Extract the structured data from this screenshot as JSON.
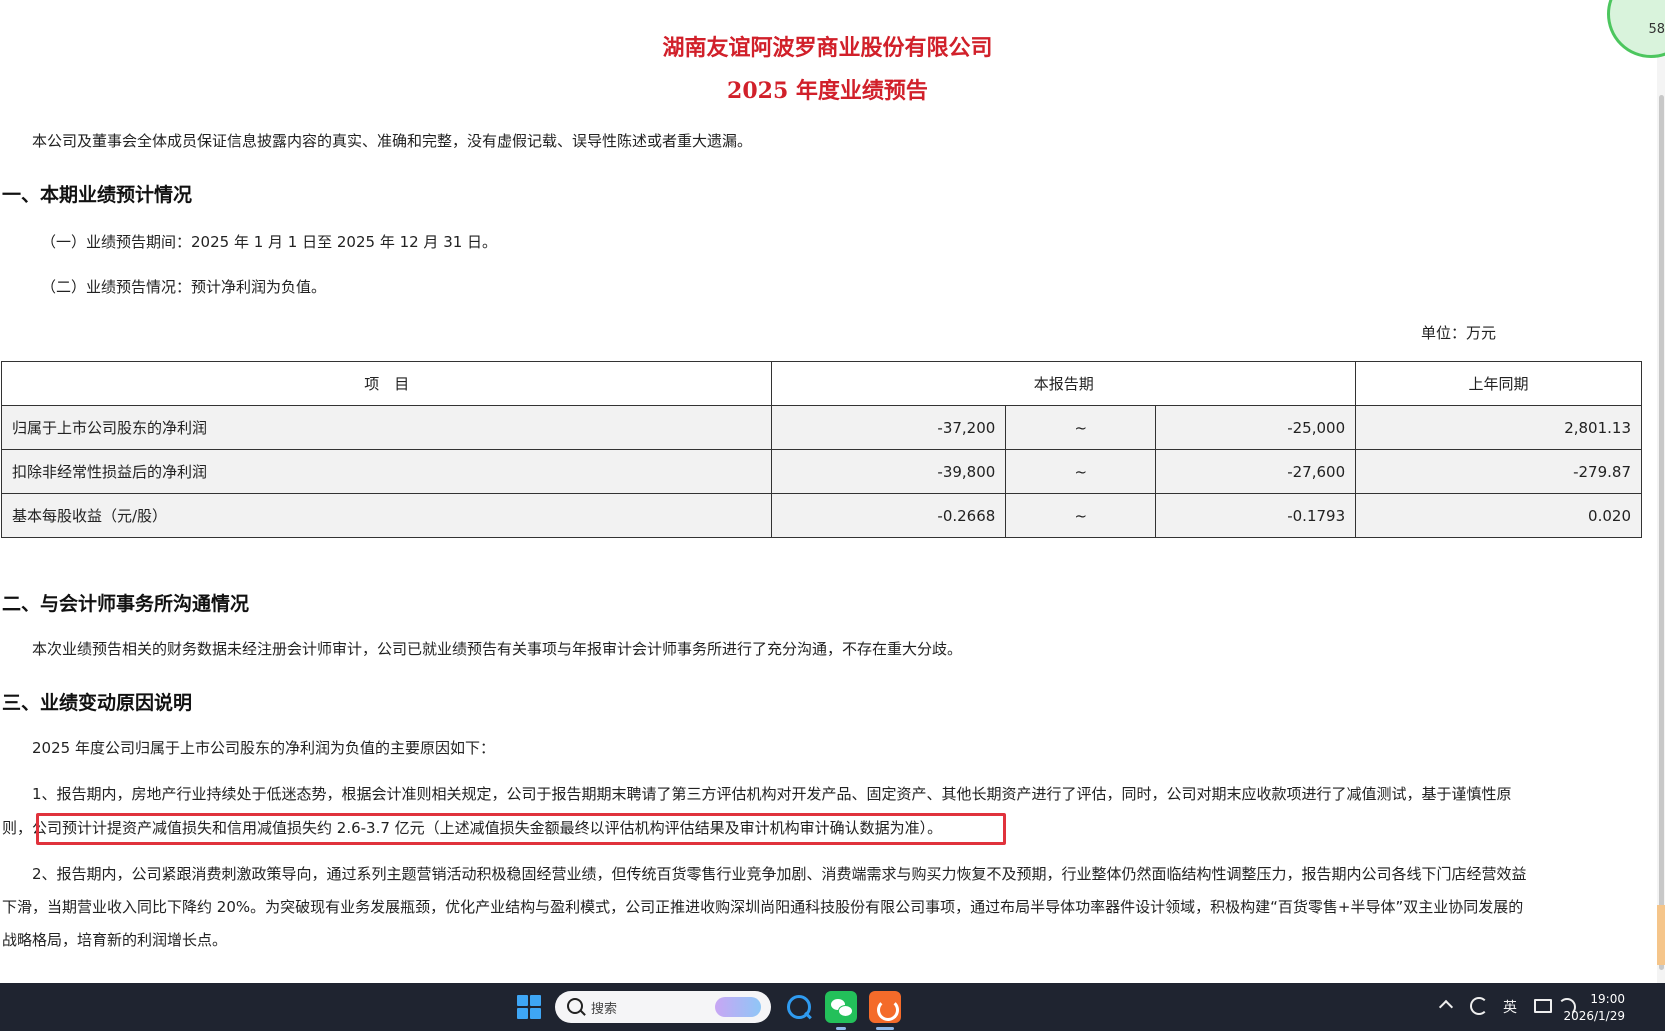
{
  "document": {
    "company": "湖南友谊阿波罗商业股份有限公司",
    "title": "2025 年度业绩预告",
    "disclaimer": "本公司及董事会全体成员保证信息披露内容的真实、准确和完整，没有虚假记载、误导性陈述或者重大遗漏。",
    "section1": {
      "heading": "一、本期业绩预计情况",
      "period": "（一）业绩预告期间：2025 年 1 月 1 日至 2025 年 12 月 31 日。",
      "situation": "（二）业绩预告情况：预计净利润为负值。",
      "unit": "单位：万元"
    },
    "table": {
      "headers": [
        "项　目",
        "本报告期",
        "上年同期"
      ],
      "rows": [
        {
          "item": "归属于上市公司股东的净利润",
          "low": "-37,200",
          "sep": "~",
          "high": "-25,000",
          "prior": "2,801.13"
        },
        {
          "item": "扣除非经常性损益后的净利润",
          "low": "-39,800",
          "sep": "~",
          "high": "-27,600",
          "prior": "-279.87"
        },
        {
          "item": "基本每股收益（元/股）",
          "low": "-0.2668",
          "sep": "~",
          "high": "-0.1793",
          "prior": "0.020"
        }
      ]
    },
    "section2": {
      "heading": "二、与会计师事务所沟通情况",
      "body": "本次业绩预告相关的财务数据未经注册会计师审计，公司已就业绩预告有关事项与年报审计会计师事务所进行了充分沟通，不存在重大分歧。"
    },
    "section3": {
      "heading": "三、业绩变动原因说明",
      "intro": "2025 年度公司归属于上市公司股东的净利润为负值的主要原因如下：",
      "reason1_line1": "1、报告期内，房地产行业持续处于低迷态势，根据会计准则相关规定，公司于报告期期末聘请了第三方评估机构对开发产品、固定资产、其他长期资产进行了评估，同时，公司对期末应收款项进行了减值测试，基于谨慎性原",
      "reason1_line2": "则，公司预计计提资产减值损失和信用减值损失约 2.6-3.7 亿元（上述减值损失金额最终以评估机构评估结果及审计机构审计确认数据为准）。",
      "reason2_line1": "2、报告期内，公司紧跟消费刺激政策导向，通过系列主题营销活动积极稳固经营业绩，但传统百货零售行业竞争加剧、消费端需求与购买力恢复不及预期，行业整体仍然面临结构性调整压力，报告期内公司各线下门店经营效益",
      "reason2_line2": "下滑，当期营业收入同比下降约 20%。为突破现有业务发展瓶颈，优化产业结构与盈利模式，公司正推进收购深圳尚阳通科技股份有限公司事项，通过布局半导体功率器件设计领域，积极构建“百货零售+半导体”双主业协同发展的",
      "reason2_line3": "战略格局，培育新的利润增长点。"
    }
  },
  "badge": {
    "text": "58"
  },
  "taskbar": {
    "search_placeholder": "搜索",
    "ime": "英",
    "time": "19:00",
    "date": "2026/1/29"
  },
  "colors": {
    "title_red": "#d1202a",
    "highlight_red": "#e0323c",
    "taskbar_bg": "#1f2430"
  }
}
